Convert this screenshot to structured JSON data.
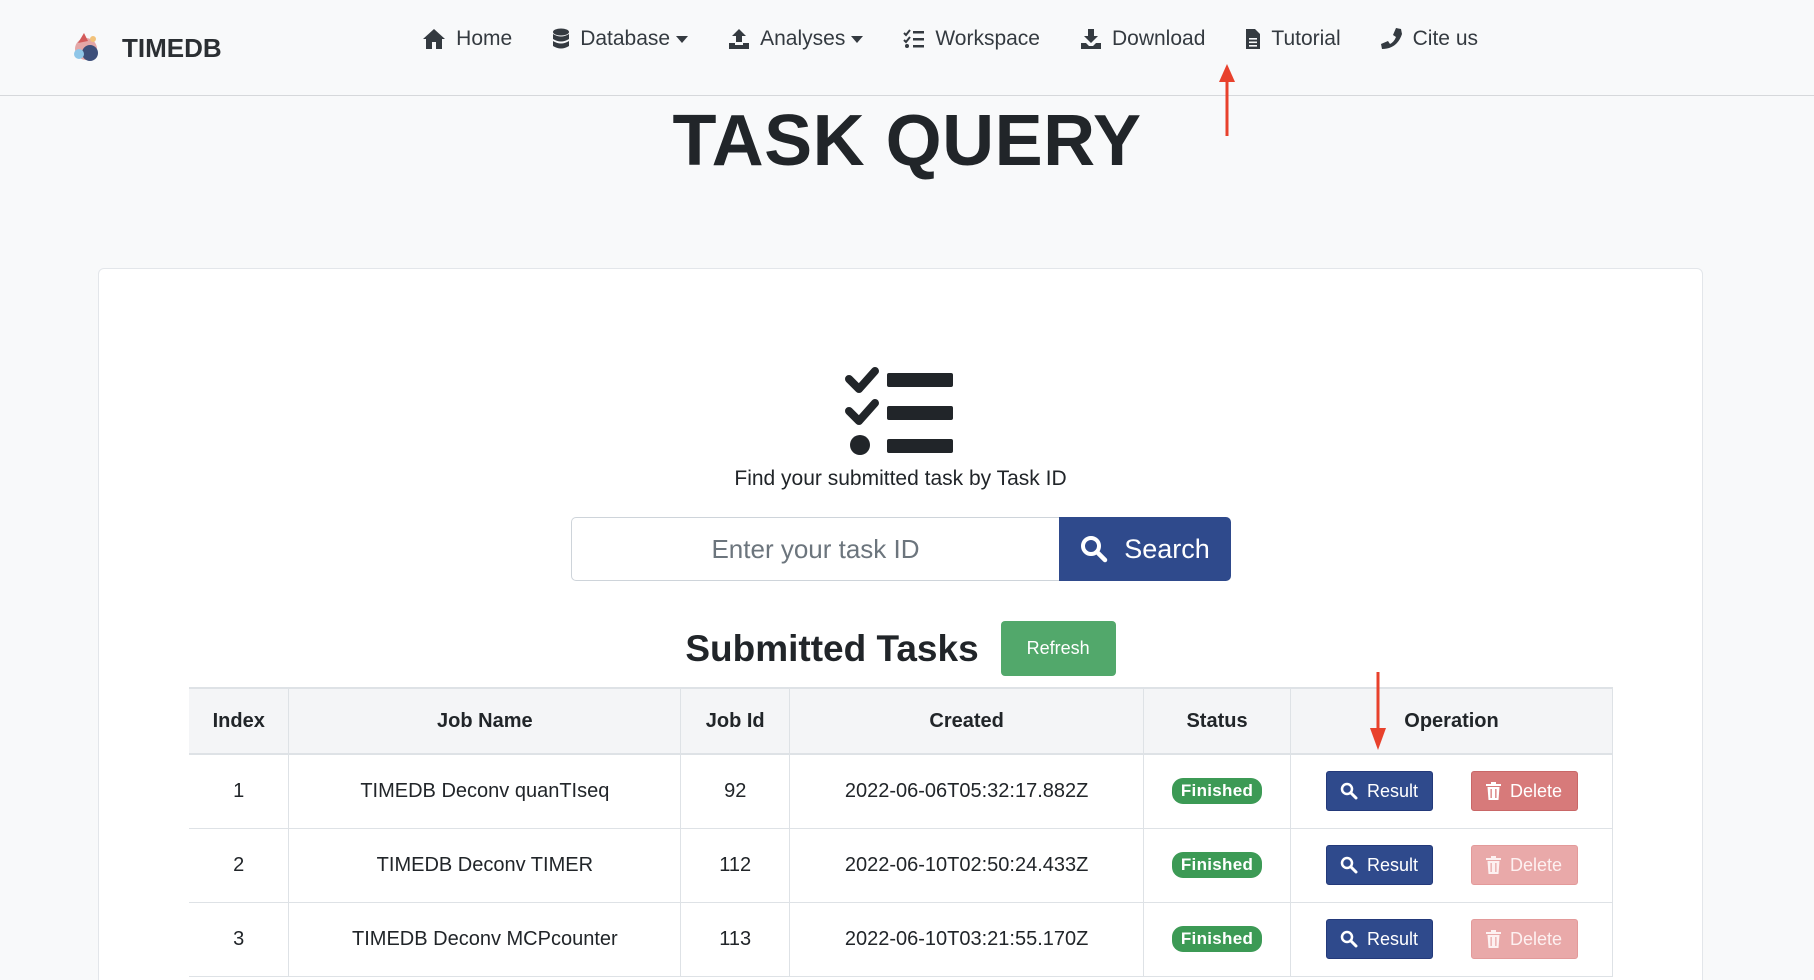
{
  "brand": {
    "name": "TIMEDB"
  },
  "nav": {
    "items": [
      {
        "label": "Home",
        "icon": "home-icon",
        "dropdown": false
      },
      {
        "label": "Database",
        "icon": "database-icon",
        "dropdown": true
      },
      {
        "label": "Analyses",
        "icon": "upload-icon",
        "dropdown": true
      },
      {
        "label": "Workspace",
        "icon": "tasks-icon",
        "dropdown": false
      },
      {
        "label": "Download",
        "icon": "download-icon",
        "dropdown": false
      },
      {
        "label": "Tutorial",
        "icon": "file-icon",
        "dropdown": false
      },
      {
        "label": "Cite us",
        "icon": "phone-icon",
        "dropdown": false
      }
    ]
  },
  "page": {
    "title": "TASK QUERY"
  },
  "query": {
    "subtitle": "Find your submitted task by Task ID",
    "placeholder": "Enter your task ID",
    "search_label": "Search"
  },
  "tasks": {
    "title": "Submitted Tasks",
    "refresh_label": "Refresh",
    "columns": [
      "Index",
      "Job Name",
      "Job Id",
      "Created",
      "Status",
      "Operation"
    ],
    "rows": [
      {
        "index": "1",
        "job_name": "TIMEDB Deconv quanTIseq",
        "job_id": "92",
        "created": "2022-06-06T05:32:17.882Z",
        "status": "Finished",
        "result_label": "Result",
        "delete_label": "Delete"
      },
      {
        "index": "2",
        "job_name": "TIMEDB Deconv TIMER",
        "job_id": "112",
        "created": "2022-06-10T02:50:24.433Z",
        "status": "Finished",
        "result_label": "Result",
        "delete_label": "Delete"
      },
      {
        "index": "3",
        "job_name": "TIMEDB Deconv MCPcounter",
        "job_id": "113",
        "created": "2022-06-10T03:21:55.170Z",
        "status": "Finished",
        "result_label": "Result",
        "delete_label": "Delete"
      }
    ]
  },
  "colors": {
    "primary": "#2f4a8c",
    "success": "#52a86b",
    "danger": "#d77a7a",
    "annotation": "#e8412c"
  }
}
